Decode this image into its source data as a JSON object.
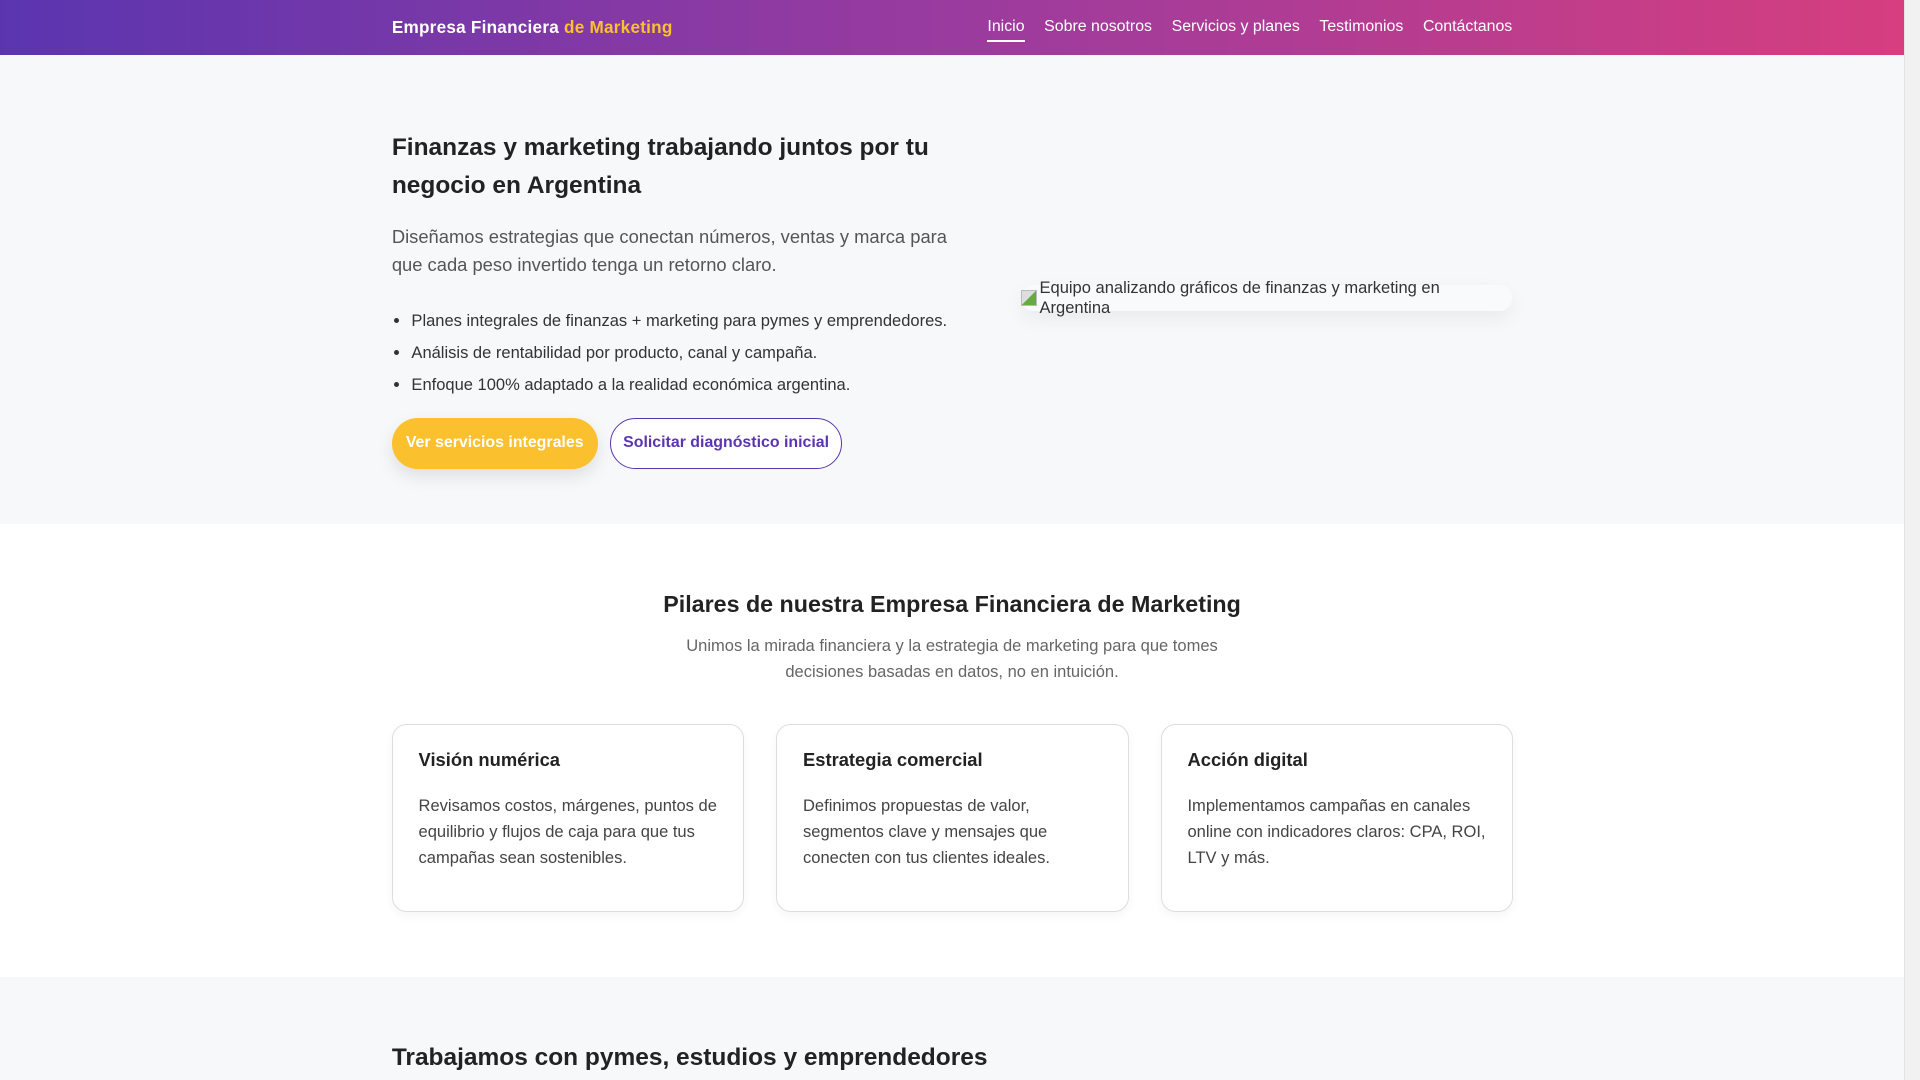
{
  "header": {
    "brand_main": "Empresa Financiera",
    "brand_accent": "de Marketing",
    "nav": [
      "Inicio",
      "Sobre nosotros",
      "Servicios y planes",
      "Testimonios",
      "Contáctanos"
    ]
  },
  "hero": {
    "title": "Finanzas y marketing trabajando juntos por tu negocio en Argentina",
    "paragraph": "Diseñamos estrategias que conectan números, ventas y marca para que cada peso invertido tenga un retorno claro.",
    "bullets": [
      "Planes integrales de finanzas + marketing para pymes y emprendedores.",
      "Análisis de rentabilidad por producto, canal y campaña.",
      "Enfoque 100% adaptado a la realidad económica argentina."
    ],
    "primary_button": "Ver servicios integrales",
    "secondary_button": "Solicitar diagnóstico inicial",
    "image_alt": "Equipo analizando gráficos de finanzas y marketing en Argentina"
  },
  "pillars": {
    "title": "Pilares de nuestra Empresa Financiera de Marketing",
    "subtitle": "Unimos la mirada financiera y la estrategia de marketing para que tomes decisiones basadas en datos, no en intuición.",
    "cards": [
      {
        "title": "Visión numérica",
        "text": "Revisamos costos, márgenes, puntos de equilibrio y flujos de caja para que tus campañas sean sostenibles."
      },
      {
        "title": "Estrategia comercial",
        "text": "Definimos propuestas de valor, segmentos clave y mensajes que conecten con tus clientes ideales."
      },
      {
        "title": "Acción digital",
        "text": "Implementamos campañas en canales online con indicadores claros: CPA, ROI, LTV y más."
      }
    ]
  },
  "clients": {
    "title": "Trabajamos con pymes, estudios y emprendedores"
  },
  "colors": {
    "accent": "#fbc02d",
    "primary": "#5b35b0",
    "gradient_end": "#d63e7f"
  }
}
